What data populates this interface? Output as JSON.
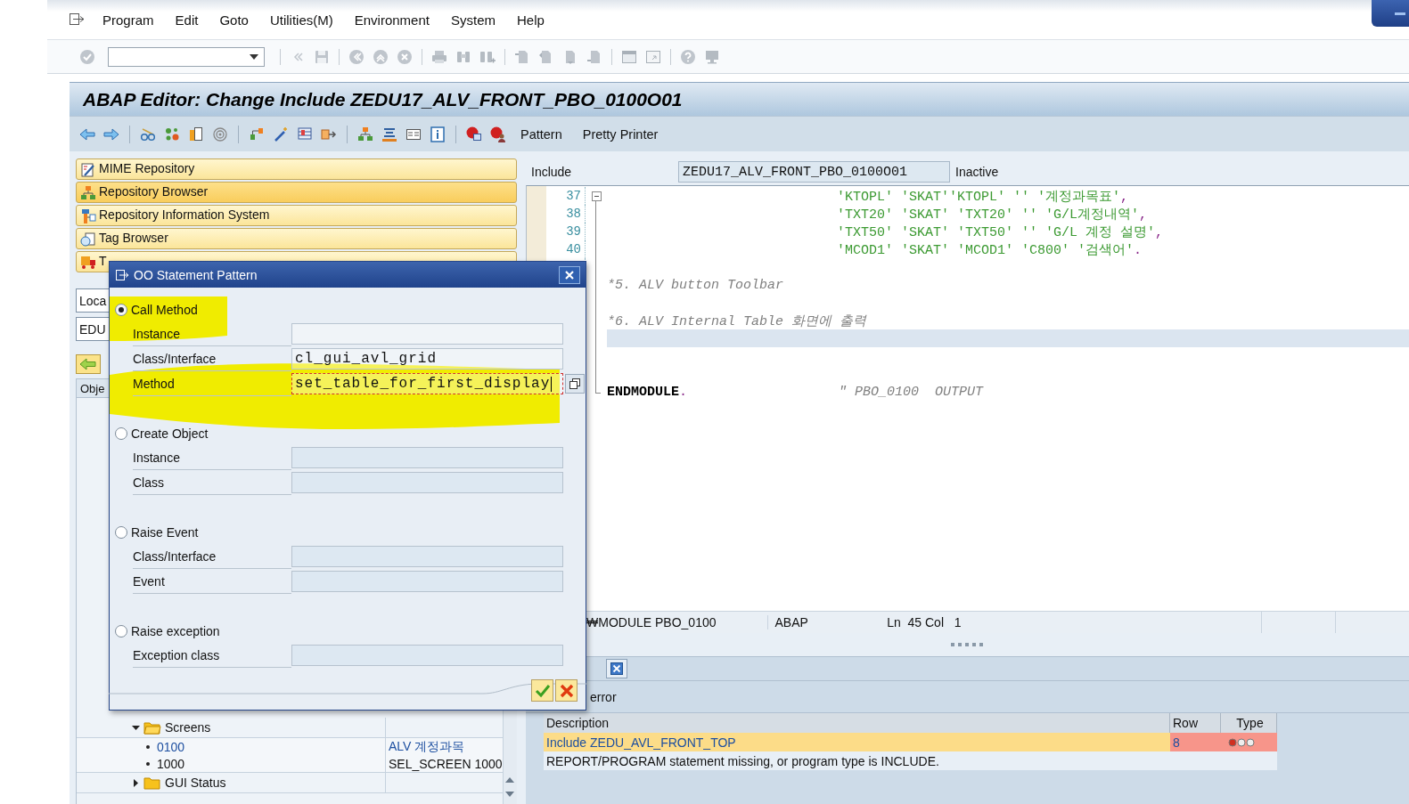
{
  "menu_bar": {
    "items": [
      "Program",
      "Edit",
      "Goto",
      "Utilities(M)",
      "Environment",
      "System",
      "Help"
    ]
  },
  "title": "ABAP Editor: Change Include ZEDU17_ALV_FRONT_PBO_0100O01",
  "application_toolbar": {
    "buttons": [
      "Pattern",
      "Pretty Printer"
    ]
  },
  "navigation": {
    "buttons": [
      {
        "label": "MIME Repository",
        "selected": false
      },
      {
        "label": "Repository Browser",
        "selected": true
      },
      {
        "label": "Repository Information System",
        "selected": false
      },
      {
        "label": "Tag Browser",
        "selected": false
      },
      {
        "label": "T",
        "selected": false
      }
    ]
  },
  "object_selector": {
    "fields": [
      "Loca",
      "EDU"
    ],
    "list_header": "Obje"
  },
  "object_tree": [
    {
      "label": "Screens",
      "expanded": true,
      "children": [
        {
          "label": "0100",
          "description": "ALV 계정과목",
          "selected": true
        },
        {
          "label": "1000",
          "description": "SEL_SCREEN 1000",
          "selected": false
        }
      ]
    },
    {
      "label": "GUI Status",
      "expanded": false
    }
  ],
  "editor": {
    "include_label": "Include",
    "include_name": "ZEDU17_ALV_FRONT_PBO_0100O01",
    "status": "Inactive",
    "lines": [
      {
        "number": "37",
        "collapsible": true,
        "block_end": false,
        "kind": "continuation",
        "segments": [
          {
            "text": "'KTOPL' 'SKAT''KTOPL' '' '계정과목표'",
            "kind": "string"
          },
          {
            "text": ",",
            "kind": "punct"
          }
        ]
      },
      {
        "number": "38",
        "collapsible": false,
        "block_end": false,
        "kind": "continuation",
        "segments": [
          {
            "text": "'TXT20' 'SKAT' 'TXT20' '' 'G/L계정내역'",
            "kind": "string"
          },
          {
            "text": ",",
            "kind": "punct"
          }
        ]
      },
      {
        "number": "39",
        "collapsible": false,
        "block_end": false,
        "kind": "continuation",
        "segments": [
          {
            "text": "'TXT50' 'SKAT' 'TXT50' '' 'G/L 계정 설명'",
            "kind": "string"
          },
          {
            "text": ",",
            "kind": "punct"
          }
        ]
      },
      {
        "number": "40",
        "collapsible": false,
        "block_end": false,
        "kind": "continuation",
        "segments": [
          {
            "text": "'MCOD1' 'SKAT' 'MCOD1' 'C800' '검색어'",
            "kind": "string"
          },
          {
            "text": ".",
            "kind": "punct"
          }
        ]
      },
      {
        "collapsible": false,
        "block_end": false,
        "kind": "blank"
      },
      {
        "collapsible": false,
        "block_end": false,
        "kind": "statement",
        "segments": [
          {
            "text": "*5. ALV button Toolbar",
            "kind": "comment"
          }
        ]
      },
      {
        "collapsible": false,
        "block_end": false,
        "kind": "blank"
      },
      {
        "collapsible": false,
        "block_end": false,
        "kind": "statement",
        "segments": [
          {
            "text": "*6. ALV Internal Table 화면에 출력",
            "kind": "comment"
          }
        ]
      },
      {
        "collapsible": false,
        "block_end": false,
        "kind": "current"
      },
      {
        "collapsible": false,
        "block_end": false,
        "kind": "blank"
      },
      {
        "collapsible": false,
        "block_end": false,
        "kind": "blank"
      },
      {
        "collapsible": false,
        "block_end": true,
        "kind": "statement",
        "segments": [
          {
            "text": "ENDMODULE",
            "kind": "keyword"
          },
          {
            "text": ".",
            "kind": "punct"
          },
          {
            "text": "\" PBO_0100  OUTPUT",
            "kind": "trailing_comment"
          }
        ]
      }
    ]
  },
  "status_line": {
    "context": "₩MODULE PBO_0100",
    "language": "ABAP",
    "line_label": "Ln",
    "line": "45",
    "column_label": "Col",
    "column": "1"
  },
  "messages": {
    "filter": "error",
    "columns": [
      "Description",
      "Row",
      "Type"
    ],
    "rows": [
      {
        "description": "Include ZEDU_AVL_FRONT_TOP",
        "row": "8",
        "error": true,
        "selected": true
      },
      {
        "description": "REPORT/PROGRAM statement missing, or program type is INCLUDE.",
        "error": false,
        "selected": false
      }
    ]
  },
  "dialog": {
    "title": "OO Statement Pattern",
    "options": [
      {
        "label": "Call Method",
        "selected": true,
        "fields": [
          {
            "label": "Instance",
            "enabled": true,
            "focused": false
          },
          {
            "label": "Class/Interface",
            "value": "cl_gui_avl_grid",
            "enabled": true,
            "focused": false
          },
          {
            "label": "Method",
            "value": "set_table_for_first_display",
            "enabled": true,
            "focused": true
          }
        ]
      },
      {
        "label": "Create Object",
        "selected": false,
        "fields": [
          {
            "label": "Instance",
            "enabled": false,
            "focused": false
          },
          {
            "label": "Class",
            "enabled": false,
            "focused": false
          }
        ]
      },
      {
        "label": "Raise Event",
        "selected": false,
        "fields": [
          {
            "label": "Class/Interface",
            "enabled": false,
            "focused": false
          },
          {
            "label": "Event",
            "enabled": false,
            "focused": false
          }
        ]
      },
      {
        "label": "Raise exception",
        "selected": false,
        "fields": [
          {
            "label": "Exception class",
            "enabled": false,
            "focused": false
          }
        ]
      }
    ]
  }
}
